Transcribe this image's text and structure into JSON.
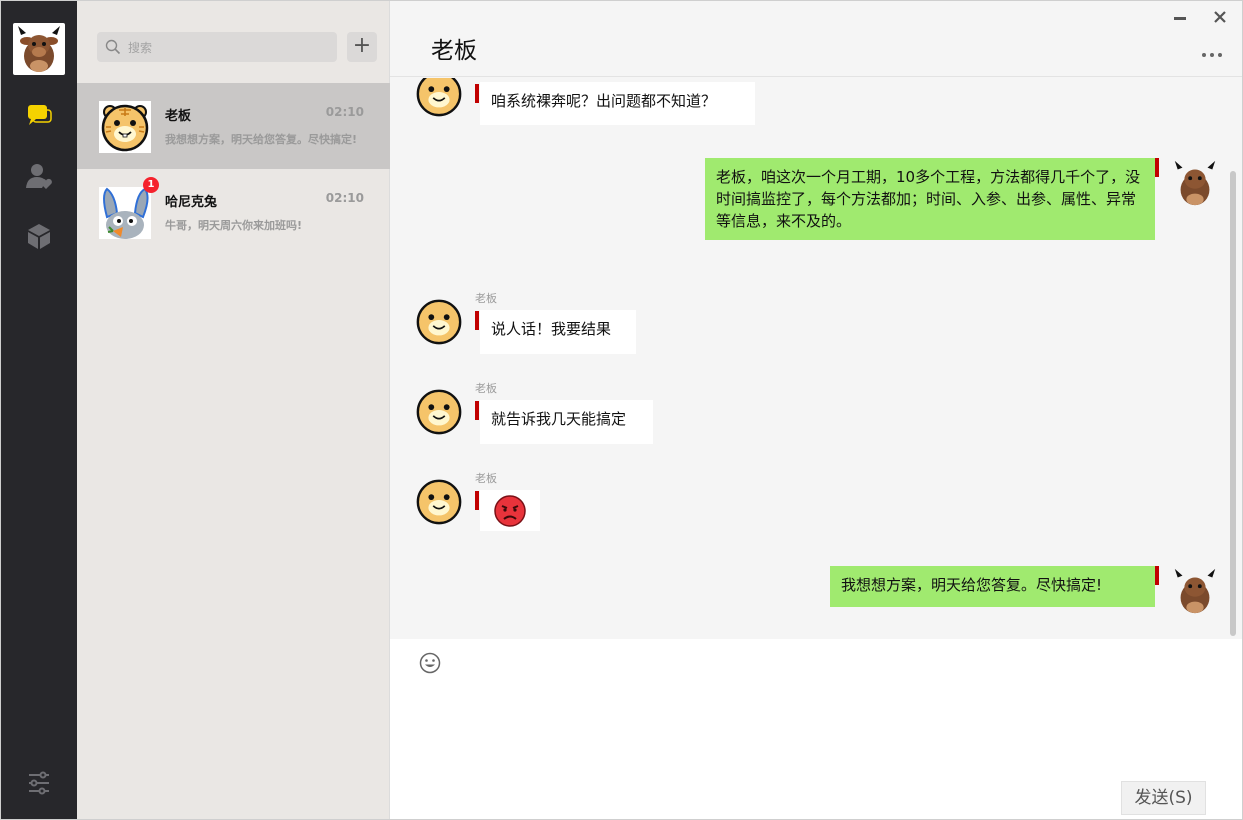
{
  "sidebar": {
    "nav": [
      "chat-icon",
      "contacts-icon",
      "box-icon"
    ],
    "settings_icon": "settings-sliders-icon",
    "accent": "#f5d200"
  },
  "contacts": {
    "search_placeholder": "搜索",
    "add_label": "+",
    "items": [
      {
        "name": "老板",
        "time": "02:10",
        "preview": "我想想方案，明天给您答复。尽快搞定!",
        "active": true
      },
      {
        "name": "哈尼克兔",
        "time": "02:10",
        "preview": "牛哥，明天周六你来加班吗!",
        "badge": "1"
      }
    ]
  },
  "chat": {
    "title": "老板",
    "messages": [
      {
        "dir": "in",
        "sender": "",
        "text": "咱系统裸奔呢？出问题都不知道？"
      },
      {
        "dir": "out",
        "text": "老板，咱这次一个月工期，10多个工程，方法都得几千个了，没时间搞监控了，每个方法都加；时间、入参、出参、属性、异常等信息，来不及的。"
      },
      {
        "dir": "in",
        "sender": "老板",
        "text": "说人话！我要结果"
      },
      {
        "dir": "in",
        "sender": "老板",
        "text": "就告诉我几天能搞定"
      },
      {
        "dir": "in",
        "sender": "老板",
        "text": "",
        "emoji": "angry-face-icon"
      },
      {
        "dir": "out",
        "text": "我想想方案，明天给您答复。尽快搞定!"
      }
    ],
    "send_label": "发送(S)"
  },
  "colors": {
    "out_bubble": "#a0ea6f",
    "in_bubble": "#ffffff",
    "rail": "#27272b",
    "mark": "#c00000"
  }
}
